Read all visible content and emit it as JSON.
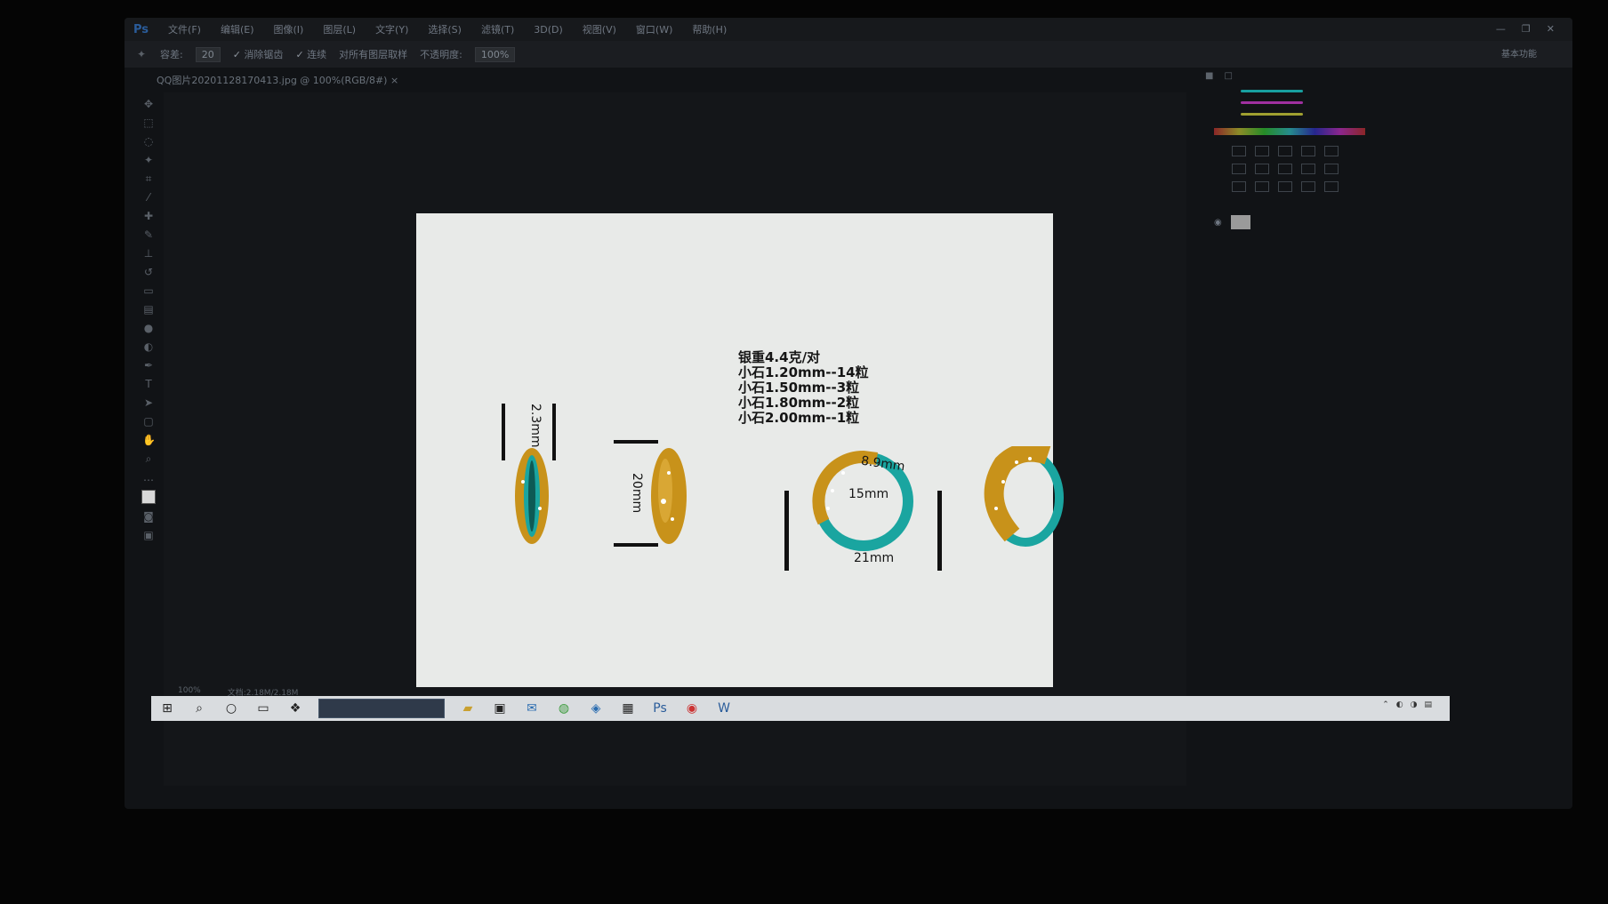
{
  "app": {
    "logo": "Ps",
    "menus": [
      "文件(F)",
      "编辑(E)",
      "图像(I)",
      "图层(L)",
      "文字(Y)",
      "选择(S)",
      "滤镜(T)",
      "3D(D)",
      "视图(V)",
      "窗口(W)",
      "帮助(H)"
    ],
    "window_controls": [
      "—",
      "❐",
      "✕"
    ]
  },
  "options": {
    "tolerance_label": "容差:",
    "tolerance_value": "20",
    "antialias_label": "消除锯齿",
    "contiguous_label": "连续",
    "all_layers_label": "对所有图层取样",
    "opacity_label": "不透明度:",
    "opacity_value": "100%",
    "workspace": "基本功能"
  },
  "document_tab": "QQ图片20201128170413.jpg @ 100%(RGB/8#)",
  "artwork": {
    "spec_lines": [
      "银重4.4克/对",
      "小石1.20mm--14粒",
      "小石1.50mm--3粒",
      "小石1.80mm--2粒",
      "小石2.00mm--1粒"
    ],
    "dim_thickness": "2.3mm",
    "dim_height": "20mm",
    "dim_band": "8.9mm",
    "dim_inner": "15mm",
    "dim_outer": "21mm"
  },
  "status": {
    "zoom": "100%",
    "doc_size": "文档:2.18M/2.18M"
  },
  "colors": {
    "gold": "#c8921a",
    "teal": "#1aa5a0",
    "paper": "#e8eae8"
  }
}
